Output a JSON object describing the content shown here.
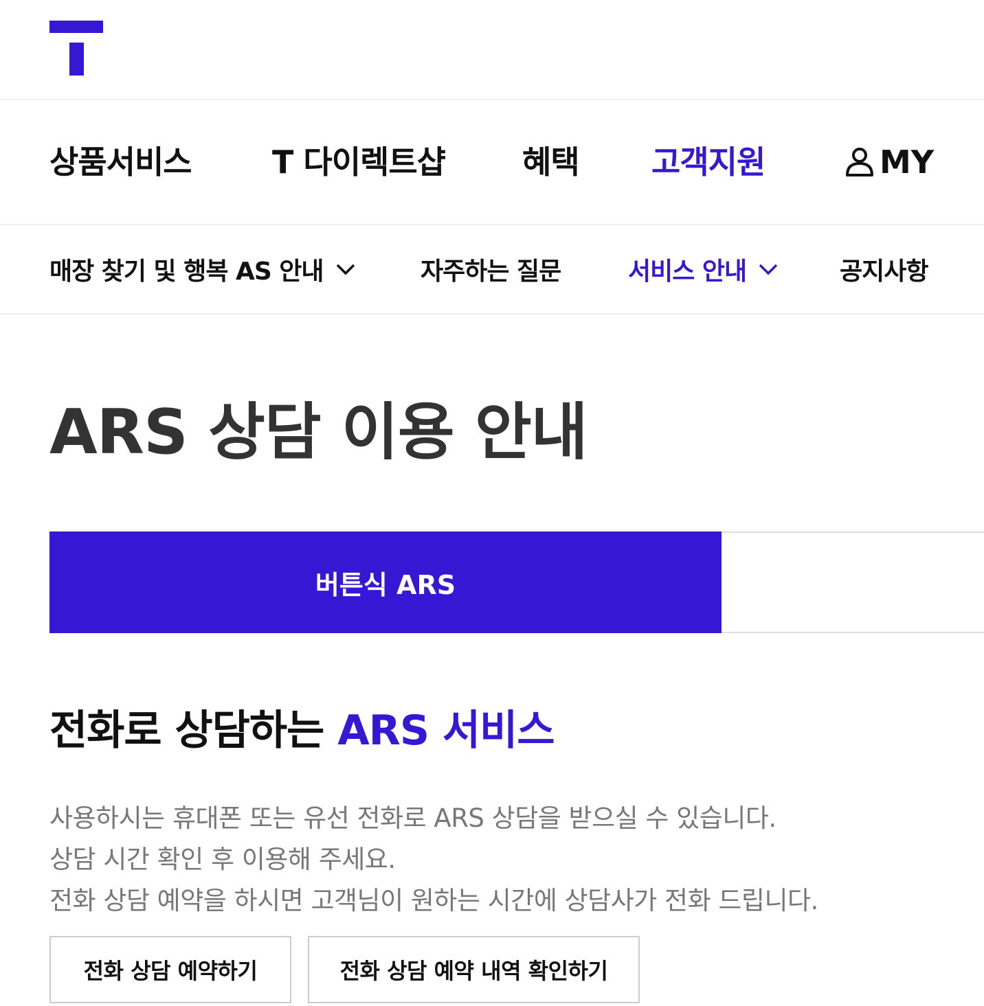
{
  "colors": {
    "brand": "#3617d3",
    "text": "#111111",
    "title": "#333333",
    "muted": "#777777"
  },
  "header": {
    "logo_text": "T",
    "logo_icon": "t-logo-icon"
  },
  "gnb": {
    "items": [
      {
        "label": "상품서비스",
        "active": false
      },
      {
        "label": "T 다이렉트샵",
        "active": false
      },
      {
        "label": "혜택",
        "active": false
      },
      {
        "label": "고객지원",
        "active": true
      }
    ],
    "my_label": "MY",
    "my_icon": "user-icon"
  },
  "lnb": {
    "items": [
      {
        "label": "매장 찾기 및 행복 AS 안내",
        "has_dropdown": true,
        "active": false
      },
      {
        "label": "자주하는 질문",
        "has_dropdown": false,
        "active": false
      },
      {
        "label": "서비스 안내",
        "has_dropdown": true,
        "active": true
      },
      {
        "label": "공지사항",
        "has_dropdown": false,
        "active": false
      }
    ]
  },
  "page": {
    "title": "ARS 상담 이용 안내"
  },
  "tabs": {
    "active_label": "버튼식 ARS"
  },
  "section": {
    "title_prefix": "전화로 상담하는 ",
    "title_highlight": "ARS 서비스",
    "lines": [
      "사용하시는 휴대폰 또는 유선 전화로 ARS 상담을 받으실 수 있습니다.",
      "상담 시간 확인 후 이용해 주세요.",
      "전화 상담 예약을 하시면 고객님이 원하는 시간에 상담사가 전화 드립니다."
    ]
  },
  "buttons": {
    "reserve": "전화 상담 예약하기",
    "check": "전화 상담 예약 내역 확인하기"
  }
}
